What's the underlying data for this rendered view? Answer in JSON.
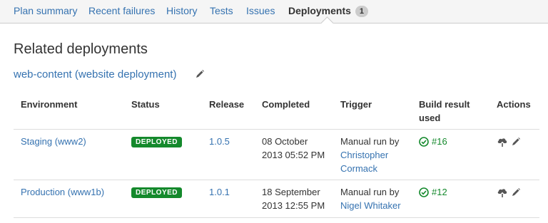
{
  "tabs": [
    {
      "label": "Plan summary"
    },
    {
      "label": "Recent failures"
    },
    {
      "label": "History"
    },
    {
      "label": "Tests"
    },
    {
      "label": "Issues"
    },
    {
      "label": "Deployments",
      "badge": "1"
    }
  ],
  "section": {
    "title": "Related deployments",
    "project_link": "web-content (website deployment)"
  },
  "table": {
    "headers": {
      "environment": "Environment",
      "status": "Status",
      "release": "Release",
      "completed": "Completed",
      "trigger": "Trigger",
      "build_line1": "Build result",
      "build_line2": "used",
      "actions": "Actions"
    },
    "rows": [
      {
        "environment": "Staging (www2)",
        "status": "DEPLOYED",
        "release": "1.0.5",
        "completed_line1": "08 October",
        "completed_line2": "2013 05:52 PM",
        "trigger_text": "Manual run by",
        "trigger_user_line1": "Christopher",
        "trigger_user_line2": "Cormack",
        "build": "#16"
      },
      {
        "environment": "Production (www1b)",
        "status": "DEPLOYED",
        "release": "1.0.1",
        "completed_line1": "18 September",
        "completed_line2": "2013 12:55 PM",
        "trigger_text": "Manual run by",
        "trigger_user_line1": "Nigel Whitaker",
        "trigger_user_line2": "",
        "build": "#12"
      }
    ]
  },
  "icons": {
    "edit": "pencil-icon",
    "deploy": "cloud-upload-icon",
    "success": "check-circle-icon"
  },
  "colors": {
    "link": "#3572b0",
    "success": "#14892c",
    "tab_bar": "#f5f5f5"
  }
}
